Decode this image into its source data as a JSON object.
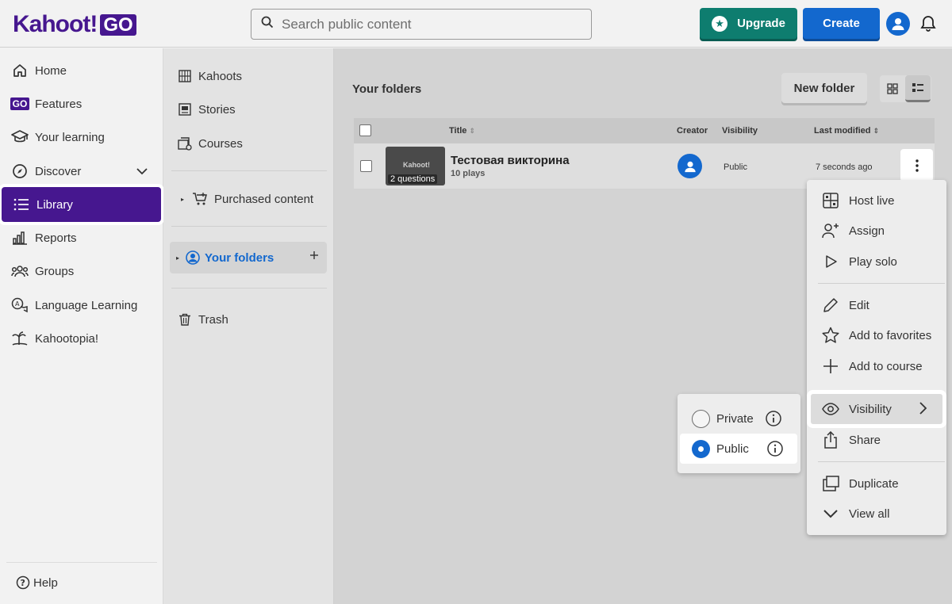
{
  "header": {
    "logo_text": "Kahoot!",
    "logo_badge": "GO",
    "search_placeholder": "Search public content",
    "upgrade_label": "Upgrade",
    "create_label": "Create"
  },
  "leftnav": {
    "items": [
      {
        "label": "Home",
        "icon": "home-icon"
      },
      {
        "label": "Features",
        "icon": "go-icon"
      },
      {
        "label": "Your learning",
        "icon": "graduation-cap-icon"
      },
      {
        "label": "Discover",
        "icon": "compass-icon"
      },
      {
        "label": "Library",
        "icon": "list-icon"
      },
      {
        "label": "Reports",
        "icon": "bar-chart-icon"
      },
      {
        "label": "Groups",
        "icon": "people-icon"
      },
      {
        "label": "Language Learning",
        "icon": "chat-translate-icon"
      },
      {
        "label": "Kahootopia!",
        "icon": "island-icon"
      }
    ],
    "help_label": "Help"
  },
  "midnav": {
    "kahoots": "Kahoots",
    "stories": "Stories",
    "courses": "Courses",
    "purchased": "Purchased content",
    "your_folders": "Your folders",
    "trash": "Trash"
  },
  "main": {
    "title": "Your folders",
    "new_folder": "New folder",
    "columns": {
      "title": "Title",
      "creator": "Creator",
      "visibility": "Visibility",
      "last_modified": "Last modified"
    },
    "rows": [
      {
        "title": "Тестовая викторина",
        "plays": "10 plays",
        "questions": "2 questions",
        "thumb_logo": "Kahoot!",
        "visibility": "Public",
        "modified": "7 seconds ago"
      }
    ]
  },
  "context_menu": {
    "items": [
      "Host live",
      "Assign",
      "Play solo",
      "Edit",
      "Add to favorites",
      "Add to course",
      "Visibility",
      "Share",
      "Duplicate",
      "View all"
    ]
  },
  "visibility_submenu": {
    "options": [
      {
        "label": "Private",
        "selected": false
      },
      {
        "label": "Public",
        "selected": true
      }
    ]
  },
  "colors": {
    "brand_purple": "#46178f",
    "upgrade_green": "#0e7d6f",
    "create_blue": "#1368ce"
  }
}
